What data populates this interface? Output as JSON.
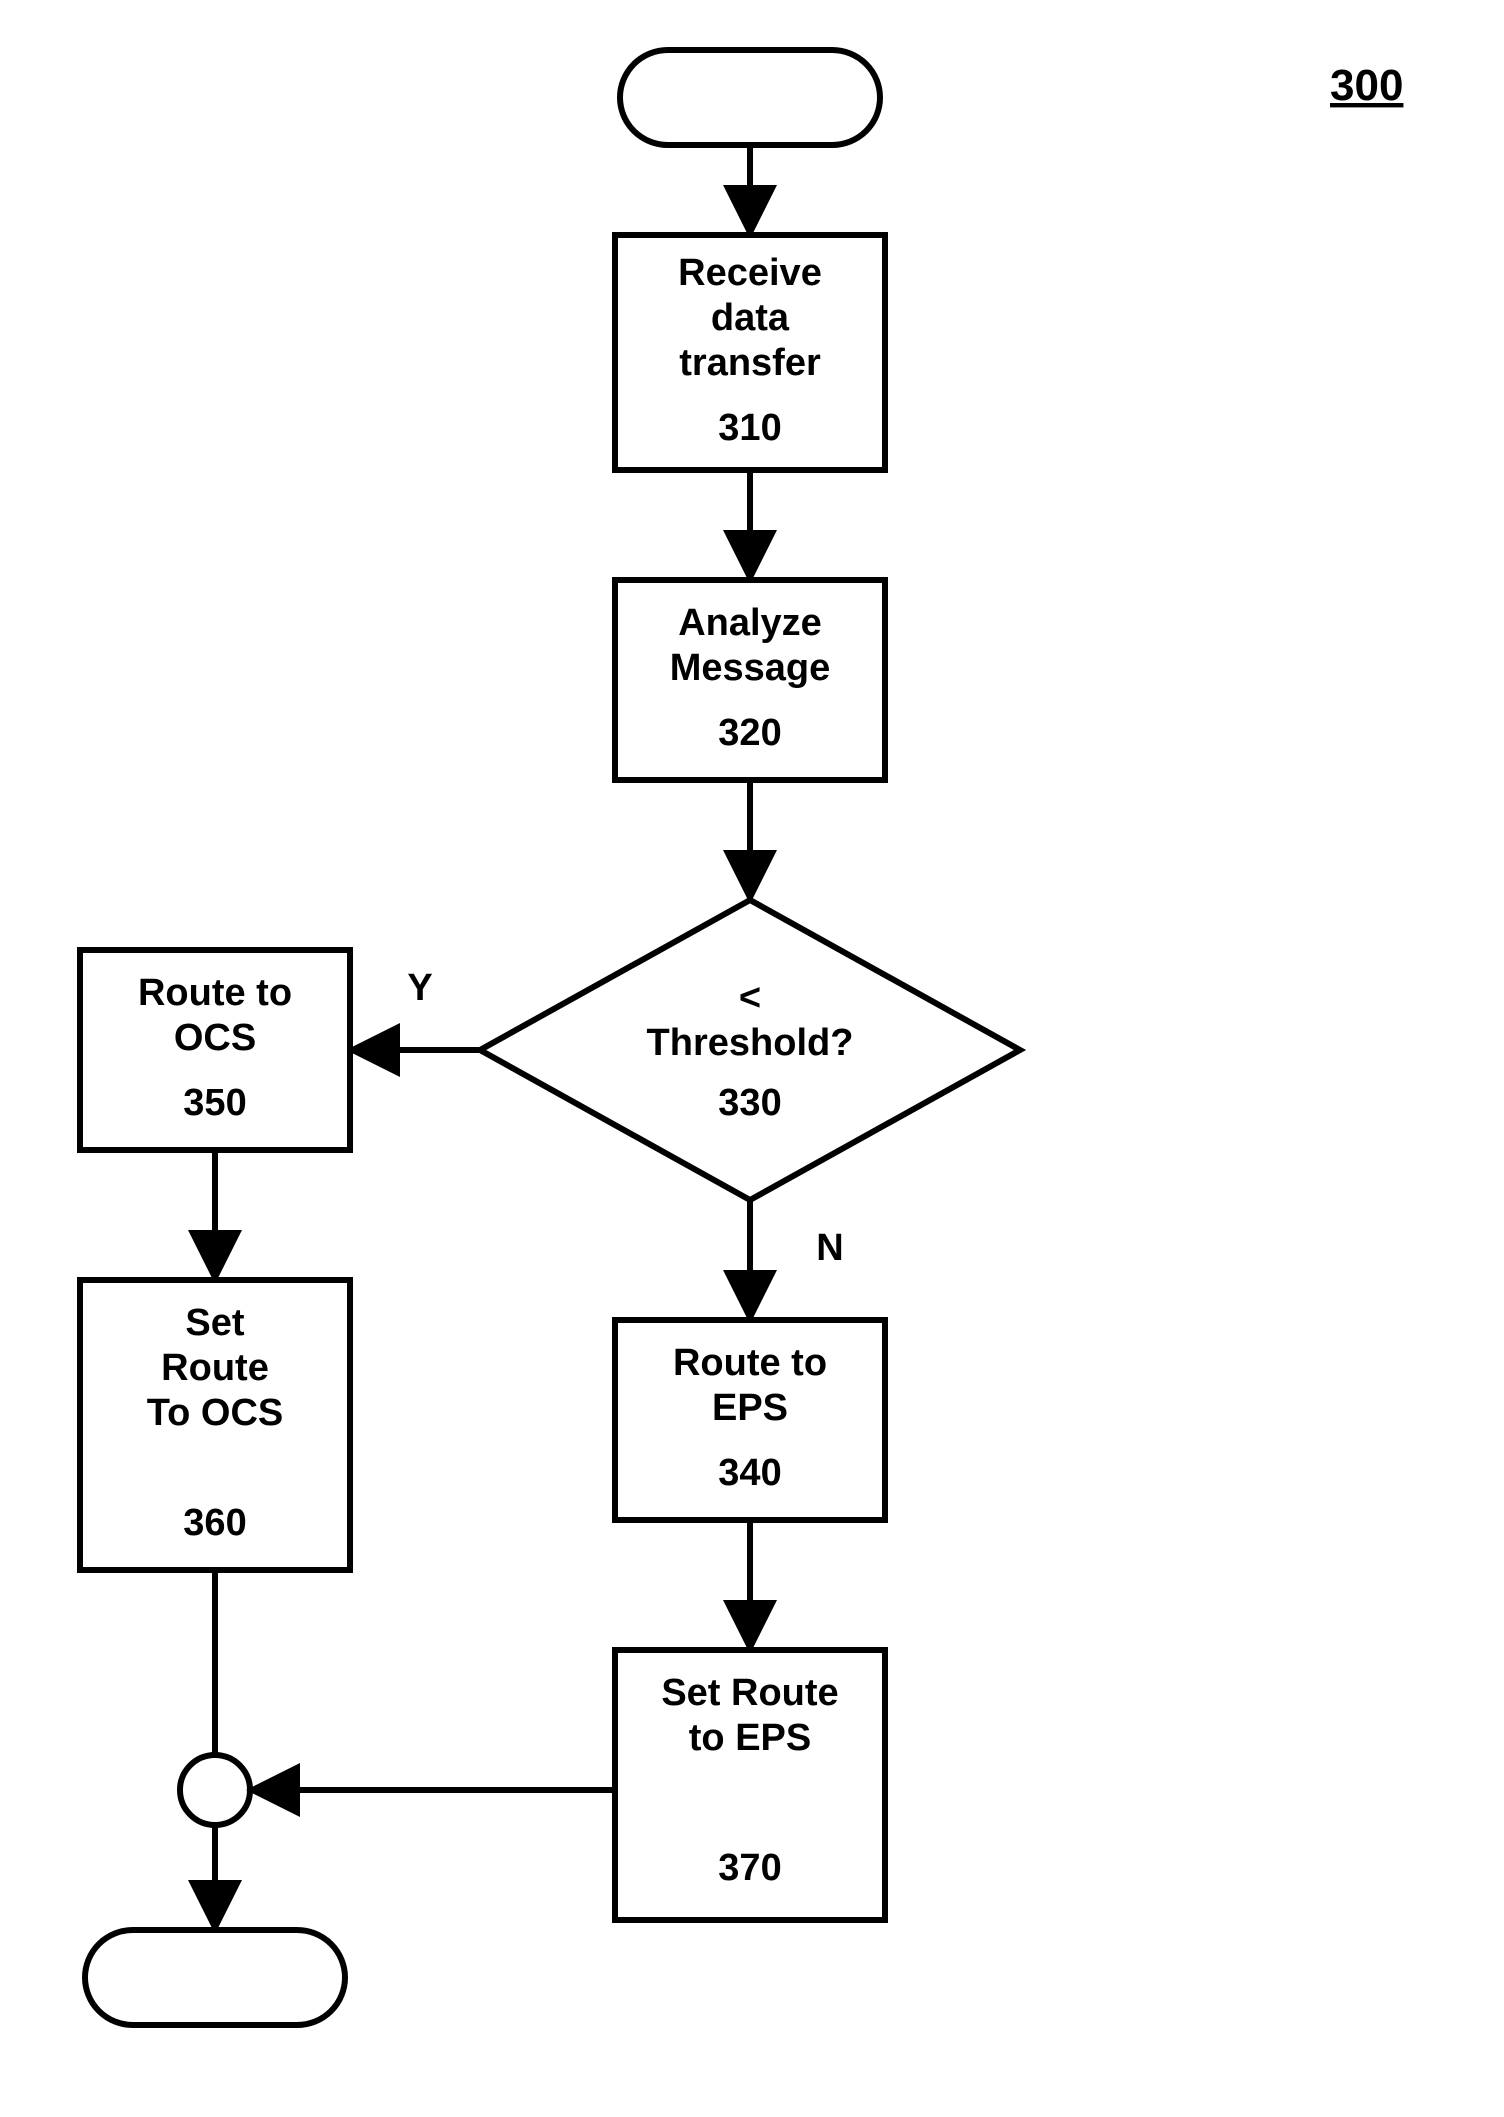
{
  "figure_label": "300",
  "nodes": {
    "receive": {
      "l1": "Receive",
      "l2": "data",
      "l3": "transfer",
      "num": "310"
    },
    "analyze": {
      "l1": "Analyze",
      "l2": "Message",
      "num": "320"
    },
    "decision": {
      "l1": "<",
      "l2": "Threshold?",
      "num": "330"
    },
    "route_eps": {
      "l1": "Route to",
      "l2": "EPS",
      "num": "340"
    },
    "route_ocs": {
      "l1": "Route to",
      "l2": "OCS",
      "num": "350"
    },
    "set_ocs": {
      "l1": "Set",
      "l2": "Route",
      "l3": "To OCS",
      "num": "360"
    },
    "set_eps": {
      "l1": "Set Route",
      "l2": "to EPS",
      "num": "370"
    }
  },
  "edges": {
    "yes": "Y",
    "no": "N"
  }
}
